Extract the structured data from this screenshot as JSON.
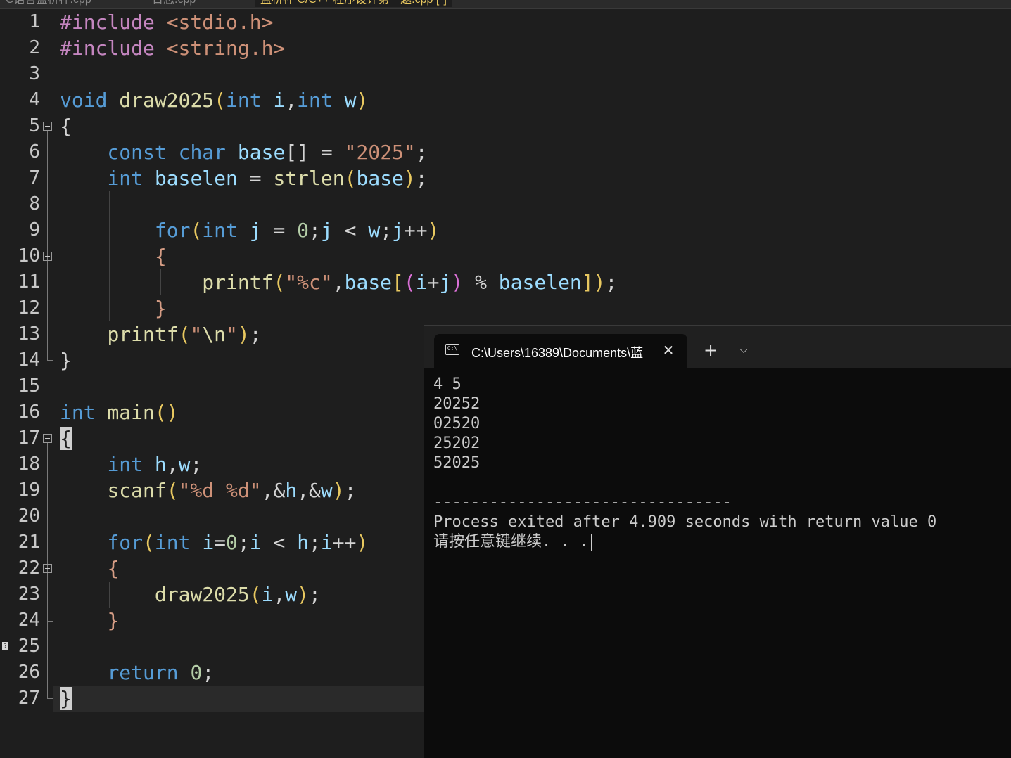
{
  "ide_tabs": [
    "C语言蓝桥杯.cpp",
    "日志.cpp",
    "蓝桥杯 C/C++ 程序设计第一题.cpp [*]"
  ],
  "editor": {
    "line_numbers": [
      "1",
      "2",
      "3",
      "4",
      "5",
      "6",
      "7",
      "8",
      "9",
      "10",
      "11",
      "12",
      "13",
      "14",
      "15",
      "16",
      "17",
      "18",
      "19",
      "20",
      "21",
      "22",
      "23",
      "24",
      "25",
      "26",
      "27"
    ],
    "code": [
      "#include <stdio.h>",
      "#include <string.h>",
      "",
      "void draw2025(int i,int w)",
      "{",
      "    const char base[] = \"2025\";",
      "    int baselen = strlen(base);",
      "",
      "        for(int j = 0;j < w;j++)",
      "        {",
      "            printf(\"%c\",base[(i+j) % baselen]);",
      "        }",
      "    printf(\"\\n\");",
      "}",
      "",
      "int main()",
      "{",
      "    int h,w;",
      "    scanf(\"%d %d\",&h,&w);",
      "",
      "    for(int i=0;i < h;i++)",
      "    {",
      "        draw2025(i,w);",
      "    }",
      "",
      "    return 0;",
      "}"
    ],
    "bookmark_label": "?"
  },
  "terminal": {
    "title": "C:\\Users\\16389\\Documents\\蓝",
    "close_glyph": "✕",
    "new_tab_glyph": "+",
    "dropdown_glyph": "⌵",
    "icon_label": "C:\\",
    "output": [
      "4 5",
      "20252",
      "02520",
      "25202",
      "52025",
      "",
      "--------------------------------",
      "Process exited after 4.909 seconds with return value 0",
      "请按任意键继续. . ."
    ]
  }
}
